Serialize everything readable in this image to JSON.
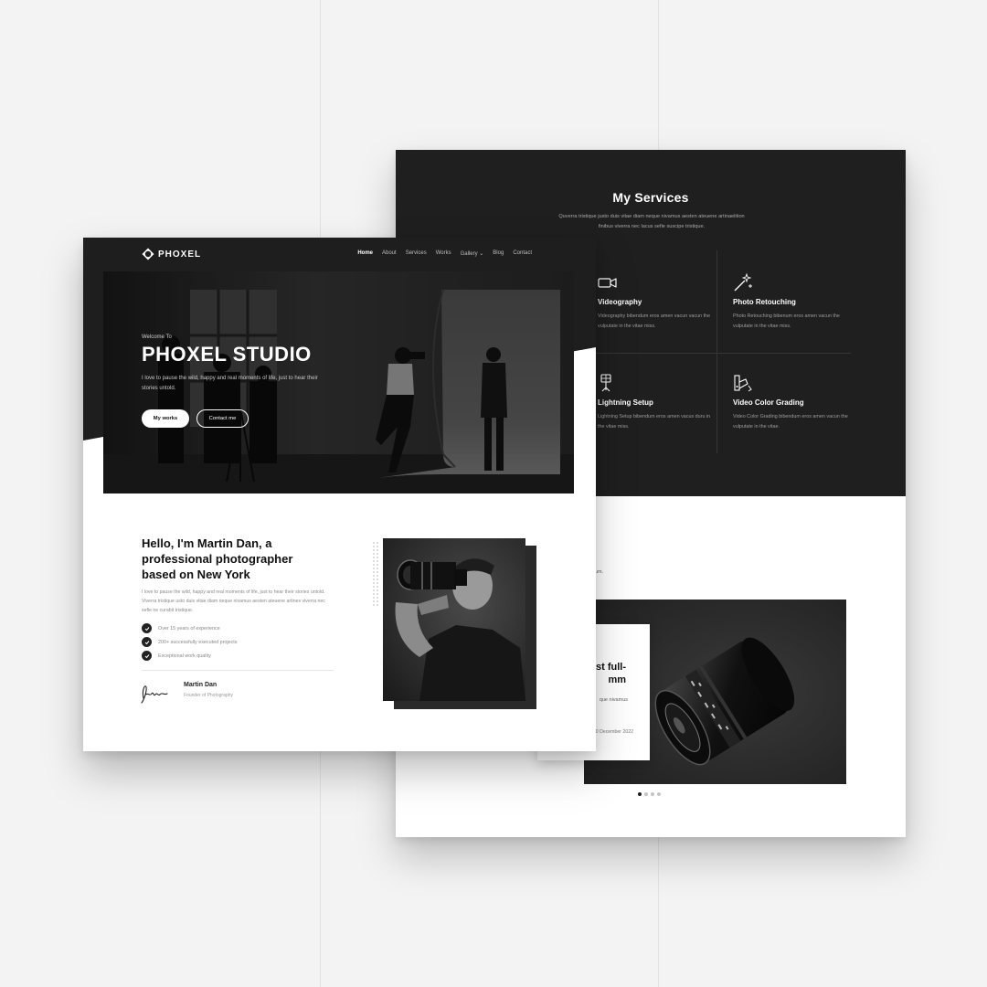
{
  "services": {
    "title": "My Services",
    "subtitle": "Quverra tristique justo duis vitae diam neque nivamus aesten ateuene artinaelition finibus viverra nec lacus sefie suscipe tristique.",
    "items": [
      {
        "name": "Videography",
        "desc": "Videography bibendum eros amen vacun vacun the vulputate in the vitae miss.",
        "icon": "video-camera-icon"
      },
      {
        "name": "Photo Retouching",
        "desc": "Photo Retouching bibenum eros amen vacun the vulputate in the vitae miss.",
        "icon": "magic-wand-icon"
      },
      {
        "name": "Lightning Setup",
        "desc": "Lightning Setup bibendum eros amen vacus duru in the vitae miss.",
        "icon": "light-setup-icon"
      },
      {
        "name": "Video Color Grading",
        "desc": "Video Color Grading bibendum eros amen vacun the vulputate in the vitae.",
        "icon": "color-grading-icon"
      }
    ]
  },
  "blog": {
    "snippet": "um.",
    "card_title_1": "st full-",
    "card_title_2": "mm",
    "card_text": "que nivamus",
    "card_date": "0 December 2022",
    "dots": 4,
    "active_dot": 0
  },
  "nav": {
    "logo": "PHOXEL",
    "links": [
      "Home",
      "About",
      "Services",
      "Works",
      "Gallery ⌄",
      "Blog",
      "Contact"
    ],
    "active": 0
  },
  "hero": {
    "welcome": "Welcome To",
    "title": "PHOXEL STUDIO",
    "desc": "I love to pause the wild, happy and real moments of life, just to hear their stories untold.",
    "primary_btn": "My works",
    "secondary_btn": "Contact me"
  },
  "about": {
    "heading": "Hello, I'm Martin Dan, a professional photographer based on New York",
    "text": "I love to pause the wild, happy and real moments of life, just to hear their stories untold. Viverra tristique usto duis vitae diam neque nivamus aesten ateuene artines viverra nec sefie ne curabit tristique.",
    "checklist": [
      "Over 15 years of experience",
      "200+ successfully executed projects",
      "Exceptional work quality"
    ],
    "author_name": "Martin Dan",
    "author_role": "Founder of Photography"
  }
}
